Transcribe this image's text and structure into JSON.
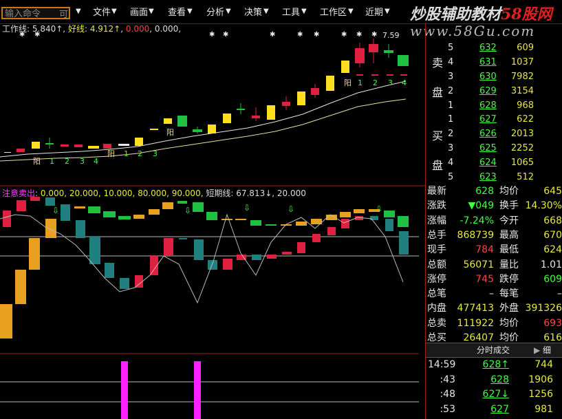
{
  "menubar": {
    "command_placeholder": "输入命令",
    "command_extra": "可",
    "items": [
      "文件",
      "画面",
      "查看",
      "分析",
      "决策",
      "工具",
      "工作区",
      "近期"
    ]
  },
  "brand": {
    "name_a": "炒股辅助教材",
    "name_b": "58股网",
    "url": "www.58Gu.com"
  },
  "indicator1": {
    "label": "工作线",
    "value1": "5.840↑",
    "good_label": "好线",
    "value2": "4.912↑",
    "value3": "0.000",
    "value4": "0.000,"
  },
  "indicator2": {
    "label": "注意卖出",
    "values": "0.000, 20.000, 10.000, 80.000, 90.000,",
    "short_label": "短期线",
    "short_value": "67.813↓, 20.000"
  },
  "chart": {
    "high_label": "7.59",
    "yang_labels": [
      "阳",
      "阳",
      "阳",
      "阳"
    ],
    "count_labels_a": [
      "1",
      "2",
      "3",
      "4"
    ],
    "count_labels_b": [
      "1",
      "2",
      "3"
    ],
    "count_labels_c": [
      "1",
      "2",
      "3",
      "4"
    ]
  },
  "orderbook": {
    "sell_title": [
      "卖",
      "盘"
    ],
    "buy_title": [
      "买",
      "盘"
    ],
    "sell": [
      {
        "level": "5",
        "price": "632",
        "vol": "609"
      },
      {
        "level": "4",
        "price": "631",
        "vol": "1037"
      },
      {
        "level": "3",
        "price": "630",
        "vol": "7982"
      },
      {
        "level": "2",
        "price": "629",
        "vol": "3154"
      },
      {
        "level": "1",
        "price": "628",
        "vol": "968"
      }
    ],
    "buy": [
      {
        "level": "1",
        "price": "627",
        "vol": "622"
      },
      {
        "level": "2",
        "price": "626",
        "vol": "2013"
      },
      {
        "level": "3",
        "price": "625",
        "vol": "2252"
      },
      {
        "level": "4",
        "price": "624",
        "vol": "1065"
      },
      {
        "level": "5",
        "price": "623",
        "vol": "512"
      }
    ]
  },
  "stats": [
    {
      "l1": "最新",
      "v1": "628",
      "l2": "均价",
      "v2": "645"
    },
    {
      "l1": "涨跌",
      "v1": "▼049",
      "l2": "换手",
      "v2": "14.30%"
    },
    {
      "l1": "涨幅",
      "v1": "-7.24%",
      "l2": "今开",
      "v2": "668"
    },
    {
      "l1": "总手",
      "v1": "868739",
      "l2": "最高",
      "v2": "670"
    },
    {
      "l1": "现手",
      "v1": "784",
      "l2": "最低",
      "v2": "624"
    },
    {
      "l1": "总额",
      "v1": "56071",
      "l2": "量比",
      "v2": "1.01"
    },
    {
      "l1": "涨停",
      "v1": "745",
      "l2": "跌停",
      "v2": "609"
    },
    {
      "l1": "总笔",
      "v1": "–",
      "l2": "每笔",
      "v2": "–"
    },
    {
      "l1": "内盘",
      "v1": "477413",
      "l2": "外盘",
      "v2": "391326"
    },
    {
      "l1": "总卖",
      "v1": "111922",
      "l2": "均价",
      "v2": "693"
    },
    {
      "l1": "总买",
      "v1": "26407",
      "l2": "均价",
      "v2": "616"
    }
  ],
  "ticks": {
    "title": "分时成交",
    "btn": "细",
    "rows": [
      {
        "time": "14:59",
        "price": "628↑",
        "vol": "744"
      },
      {
        "time": ":43",
        "price": "628",
        "vol": "1906"
      },
      {
        "time": ":48",
        "price": "627↓",
        "vol": "1256"
      },
      {
        "time": ":53",
        "price": "627",
        "vol": "981"
      }
    ]
  }
}
